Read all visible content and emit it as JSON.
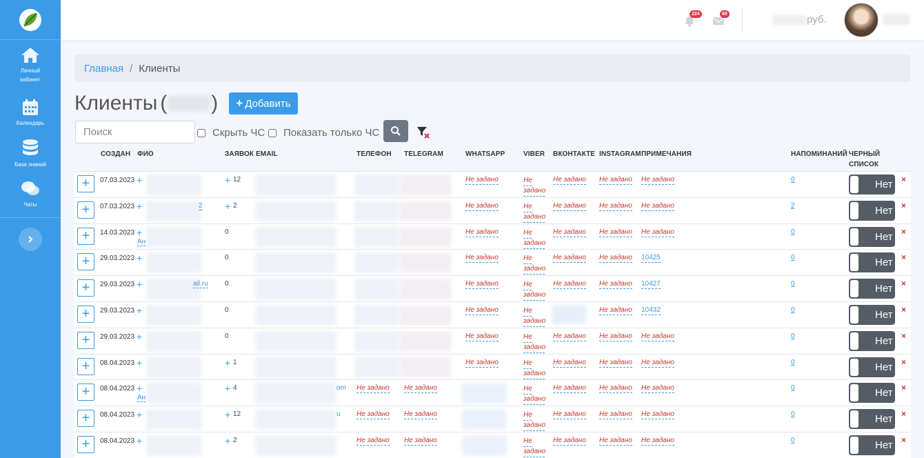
{
  "sidebar": {
    "items": [
      {
        "label": "Личный кабинет"
      },
      {
        "label": "Календарь"
      },
      {
        "label": "База знаний"
      },
      {
        "label": "Чаты"
      }
    ]
  },
  "header": {
    "notifications_count": "224",
    "messages_count": "60",
    "balance_currency": "руб."
  },
  "breadcrumb": {
    "home": "Главная",
    "separator": "/",
    "current": "Клиенты"
  },
  "page": {
    "title": "Клиенты",
    "open_paren": "(",
    "close_paren": ")",
    "add_button": "Добавить"
  },
  "filters": {
    "search_placeholder": "Поиск",
    "hide_blacklist": "Скрыть ЧС",
    "show_only_blacklist": "Показать только ЧС"
  },
  "table": {
    "columns": {
      "created": "СОЗДАН",
      "name": "ФИО",
      "requests": "ЗАЯВОК",
      "email": "EMAIL",
      "phone": "ТЕЛЕФОН",
      "telegram": "TELEGRAM",
      "whatsapp": "WHATSAPP",
      "viber": "VIBER",
      "vk": "ВКОНТАКТЕ",
      "instagram": "INSTAGRAM",
      "notes": "ПРИМЕЧАНИЯ",
      "reminders": "НАПОМИНАНИЙ",
      "blacklist": "ЧЕРНЫЙ СПИСОК"
    },
    "not_set": "Не задано",
    "not_set_split": [
      "Не",
      "задано"
    ],
    "toggle_label": "Нет",
    "delete_symbol": "×",
    "rows": [
      {
        "date": "07.03.2023",
        "requests": "12",
        "requests_plus": true,
        "name_suffix": "",
        "email_suffix": "",
        "phone_ns": false,
        "telegram_ns": false,
        "whatsapp_ns": true,
        "vk_ns": true,
        "notes": "Не задано",
        "notes_link": false,
        "reminders": "0"
      },
      {
        "date": "07.03.2023",
        "requests": "2",
        "requests_plus": true,
        "name_suffix": "2",
        "email_suffix": "",
        "phone_ns": false,
        "telegram_ns": false,
        "whatsapp_ns": true,
        "vk_ns": true,
        "notes": "Не задано",
        "notes_link": false,
        "reminders": "2"
      },
      {
        "date": "14.03.2023",
        "requests": "0",
        "requests_plus": false,
        "name_suffix": "Ан",
        "email_suffix": "",
        "phone_ns": false,
        "telegram_ns": false,
        "whatsapp_ns": true,
        "vk_ns": true,
        "notes": "Не задано",
        "notes_link": false,
        "reminders": "0"
      },
      {
        "date": "29.03.2023",
        "requests": "0",
        "requests_plus": false,
        "name_suffix": "",
        "email_suffix": "",
        "phone_ns": false,
        "telegram_ns": false,
        "whatsapp_ns": true,
        "vk_ns": true,
        "notes": "10425",
        "notes_link": true,
        "reminders": "0"
      },
      {
        "date": "29.03.2023",
        "requests": "0",
        "requests_plus": false,
        "name_suffix": "ail.ru",
        "email_suffix": "",
        "phone_ns": false,
        "telegram_ns": false,
        "whatsapp_ns": true,
        "vk_ns": true,
        "notes": "10427",
        "notes_link": true,
        "reminders": "0"
      },
      {
        "date": "29.03.2023",
        "requests": "0",
        "requests_plus": false,
        "name_suffix": "",
        "email_suffix": "",
        "phone_ns": false,
        "telegram_ns": false,
        "whatsapp_ns": true,
        "vk_ns": false,
        "notes": "10432",
        "notes_link": true,
        "reminders": "0"
      },
      {
        "date": "29.03.2023",
        "requests": "0",
        "requests_plus": false,
        "name_suffix": "",
        "email_suffix": "",
        "phone_ns": false,
        "telegram_ns": false,
        "whatsapp_ns": true,
        "vk_ns": true,
        "notes": "Не задано",
        "notes_link": false,
        "reminders": "0"
      },
      {
        "date": "08.04.2023",
        "requests": "1",
        "requests_plus": true,
        "name_suffix": "",
        "email_suffix": "",
        "phone_ns": false,
        "telegram_ns": false,
        "whatsapp_ns": true,
        "vk_ns": true,
        "notes": "Не задано",
        "notes_link": false,
        "reminders": "0"
      },
      {
        "date": "08.04.2023",
        "requests": "4",
        "requests_plus": true,
        "name_suffix": "Ан",
        "email_suffix": "om",
        "phone_ns": true,
        "telegram_ns": true,
        "whatsapp_ns": false,
        "vk_ns": true,
        "notes": "Не задано",
        "notes_link": false,
        "reminders": "0"
      },
      {
        "date": "08.04.2023",
        "requests": "12",
        "requests_plus": true,
        "name_suffix": "",
        "email_suffix": "u",
        "phone_ns": true,
        "telegram_ns": true,
        "whatsapp_ns": false,
        "vk_ns": true,
        "notes": "Не задано",
        "notes_link": false,
        "reminders": "0"
      },
      {
        "date": "08.04.2023",
        "requests": "2",
        "requests_plus": true,
        "name_suffix": "",
        "email_suffix": "",
        "phone_ns": true,
        "telegram_ns": true,
        "whatsapp_ns": false,
        "vk_ns": true,
        "notes": "Не задано",
        "notes_link": false,
        "reminders": "0"
      }
    ]
  },
  "colors": {
    "accent": "#3a9be8",
    "sidebar": "#3a9be8",
    "danger": "#c0392b",
    "badge": "#e0364d",
    "toggle": "#555c66"
  },
  "icons": {
    "logo": "leaf-logo-icon",
    "home": "home-icon",
    "calendar": "calendar-icon",
    "knowledge": "database-icon",
    "chats": "chat-bubbles-icon",
    "expand": "chevron-right-icon",
    "bell": "bell-icon",
    "mail": "envelope-icon",
    "search": "search-icon",
    "filter_clear": "filter-clear-icon"
  }
}
